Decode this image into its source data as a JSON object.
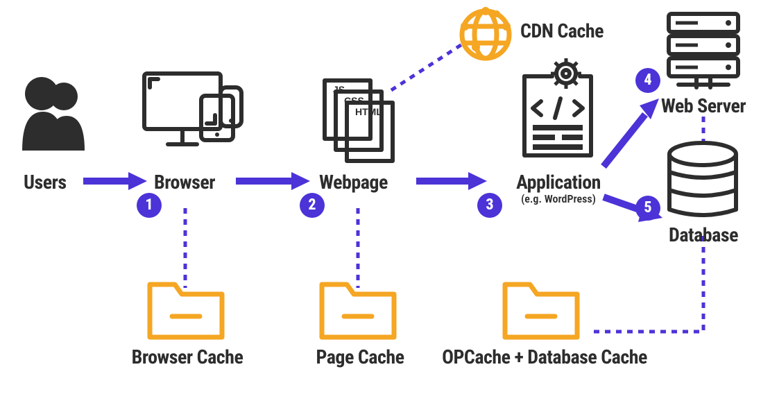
{
  "nodes": {
    "users": {
      "label": "Users"
    },
    "browser": {
      "label": "Browser"
    },
    "webpage": {
      "label": "Webpage"
    },
    "application": {
      "label": "Application",
      "sublabel": "(e.g. WordPress)"
    },
    "webserver": {
      "label": "Web Server"
    },
    "database": {
      "label": "Database"
    },
    "cdn": {
      "label": "CDN Cache"
    }
  },
  "caches": {
    "browser": {
      "label": "Browser Cache"
    },
    "page": {
      "label": "Page Cache"
    },
    "opdb": {
      "label": "OPCache + Database Cache"
    }
  },
  "files": {
    "js": "JS",
    "css": "CSS",
    "html": "HTML"
  },
  "badges": {
    "b1": "1",
    "b2": "2",
    "b3": "3",
    "b4": "4",
    "b5": "5"
  },
  "colors": {
    "accent": "#4b33d8",
    "orange": "#f5a623",
    "ink": "#2d2d2d"
  }
}
